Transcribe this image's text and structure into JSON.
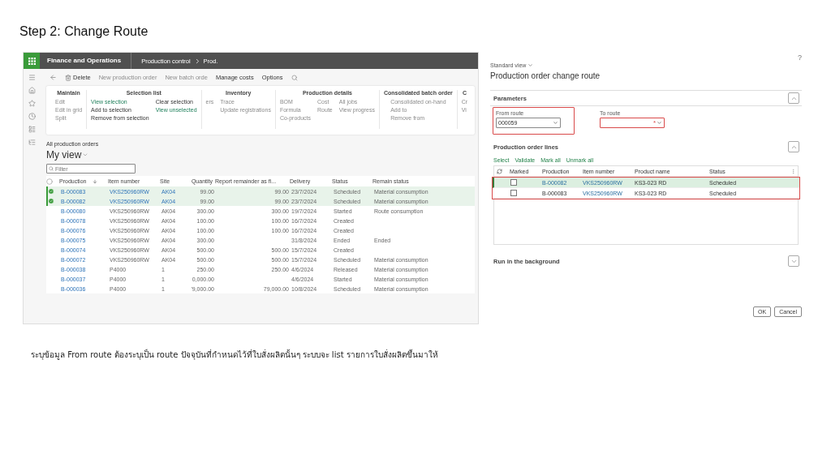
{
  "title": "Step 2: Change Route",
  "erp_window": {
    "app_title": "Finance and Operations",
    "breadcrumb": [
      "Production control",
      "Prod."
    ],
    "actions": [
      {
        "label": "Delete",
        "disabled": false,
        "kind": "delete"
      },
      {
        "label": "New production order",
        "disabled": true,
        "kind": "text"
      },
      {
        "label": "New batch orde",
        "disabled": true,
        "kind": "text"
      },
      {
        "label": "Manage costs",
        "disabled": false,
        "kind": "text"
      },
      {
        "label": "Options",
        "disabled": false,
        "kind": "text"
      }
    ],
    "ribbon": [
      {
        "title": "Maintain",
        "columns": [
          [
            {
              "label": "Edit",
              "disabled": true
            },
            {
              "label": "Edit in grid",
              "disabled": true
            },
            {
              "label": "Split",
              "disabled": true
            }
          ]
        ]
      },
      {
        "title": "Selection list",
        "columns": [
          [
            {
              "label": "View selection",
              "disabled": false,
              "link": true
            },
            {
              "label": "Add to selection",
              "disabled": false,
              "link": false
            },
            {
              "label": "Remove from selection",
              "disabled": false,
              "link": false
            }
          ],
          [
            {
              "label": "Clear selection",
              "disabled": false,
              "link": false
            },
            {
              "label": "View unselected",
              "disabled": false,
              "link": true
            }
          ]
        ]
      },
      {
        "title": "Inventory",
        "columns": [
          [
            {
              "label": "ers",
              "disabled": true
            }
          ],
          [
            {
              "label": "Trace",
              "disabled": true
            },
            {
              "label": "Update registrations",
              "disabled": true
            }
          ]
        ]
      },
      {
        "title": "Production details",
        "columns": [
          [
            {
              "label": "BOM",
              "disabled": true
            },
            {
              "label": "Formula",
              "disabled": true
            },
            {
              "label": "Co-products",
              "disabled": true
            }
          ],
          [
            {
              "label": "Cost",
              "disabled": true
            },
            {
              "label": "Route",
              "disabled": true
            }
          ],
          [
            {
              "label": "All jobs",
              "disabled": true
            },
            {
              "label": "View progress",
              "disabled": true
            }
          ]
        ]
      },
      {
        "title": "Consolidated batch order",
        "columns": [
          [
            {
              "label": "Consolidated on-hand",
              "disabled": true
            },
            {
              "label": "Add to",
              "disabled": true
            },
            {
              "label": "Remove from",
              "disabled": true
            }
          ]
        ]
      },
      {
        "title": "C",
        "columns": [
          [
            {
              "label": "Cr",
              "disabled": true
            },
            {
              "label": "Vi",
              "disabled": true
            }
          ]
        ]
      }
    ],
    "page_label": "All production orders",
    "view_name": "My view",
    "filter": {
      "placeholder": "Filter"
    },
    "table": {
      "columns": [
        "Production",
        "Item number",
        "Site",
        "Quantity",
        "Report remainder as fi...",
        "Delivery",
        "Status",
        "Remain status"
      ],
      "rows": [
        {
          "selected": true,
          "production": "B-000083",
          "item": "VKS250960RW",
          "site": "AK04",
          "quantity": "99.00",
          "remainder": "99.00",
          "delivery": "23/7/2024",
          "status": "Scheduled",
          "remain_status": "Material consumption"
        },
        {
          "selected": true,
          "production": "B-000082",
          "item": "VKS250960RW",
          "site": "AK04",
          "quantity": "99.00",
          "remainder": "99.00",
          "delivery": "23/7/2024",
          "status": "Scheduled",
          "remain_status": "Material consumption"
        },
        {
          "selected": false,
          "production": "B-000080",
          "item": "VKS250960RW",
          "site": "AK04",
          "quantity": "300.00",
          "remainder": "300.00",
          "delivery": "19/7/2024",
          "status": "Started",
          "remain_status": "Route consumption"
        },
        {
          "selected": false,
          "production": "B-000078",
          "item": "VKS250960RW",
          "site": "AK04",
          "quantity": "100.00",
          "remainder": "100.00",
          "delivery": "16/7/2024",
          "status": "Created"
        },
        {
          "selected": false,
          "production": "B-000076",
          "item": "VKS250960RW",
          "site": "AK04",
          "quantity": "100.00",
          "remainder": "100.00",
          "delivery": "16/7/2024",
          "status": "Created"
        },
        {
          "selected": false,
          "production": "B-000075",
          "item": "VKS250960RW",
          "site": "AK04",
          "quantity": "300.00",
          "delivery": "31/8/2024",
          "status": "Ended",
          "remain_status": "Ended"
        },
        {
          "selected": false,
          "production": "B-000074",
          "item": "VKS250960RW",
          "site": "AK04",
          "quantity": "500.00",
          "remainder": "500.00",
          "delivery": "15/7/2024",
          "status": "Created"
        },
        {
          "selected": false,
          "production": "B-000072",
          "item": "VKS250960RW",
          "site": "AK04",
          "quantity": "500.00",
          "remainder": "500.00",
          "delivery": "15/7/2024",
          "status": "Scheduled",
          "remain_status": "Material consumption"
        },
        {
          "selected": false,
          "production": "B-000038",
          "item": "P4000",
          "site": "1",
          "quantity": "250.00",
          "remainder": "250.00",
          "delivery": "4/6/2024",
          "status": "Released",
          "remain_status": "Material consumption"
        },
        {
          "selected": false,
          "production": "B-000037",
          "item": "P4000",
          "site": "1",
          "quantity": "0,000.00",
          "delivery": "4/6/2024",
          "status": "Started",
          "remain_status": "Material consumption"
        },
        {
          "selected": false,
          "production": "B-000036",
          "item": "P4000",
          "site": "1",
          "quantity": "'9,000.00",
          "remainder": "79,000.00",
          "delivery": "10/8/2024",
          "status": "Scheduled",
          "remain_status": "Material consumption"
        }
      ]
    }
  },
  "dialog": {
    "help": "?",
    "view_selector": "Standard view",
    "title": "Production order change route",
    "sections": [
      {
        "kind": "parameters",
        "title": "Parameters",
        "expanded": true,
        "fields": [
          {
            "label": "From route",
            "value": "000059",
            "required": false,
            "highlighted": true
          },
          {
            "label": "To route",
            "required": true,
            "highlighted": false
          }
        ]
      },
      {
        "kind": "lines",
        "title": "Production order lines",
        "expanded": true,
        "actions": [
          "Select",
          "Validate",
          "Mark all",
          "Unmark all"
        ],
        "columns": [
          "Marked",
          "Production",
          "Item number",
          "Product name",
          "Status"
        ],
        "rows_highlighted": true,
        "rows": [
          {
            "selected": true,
            "checked": false,
            "production": "B-000082",
            "item": "VKS250960RW",
            "product": "KS3-023 RD",
            "status": "Scheduled"
          },
          {
            "selected": false,
            "checked": false,
            "production": "B-000083",
            "item": "VKS250960RW",
            "product": "KS3-023 RD",
            "status": "Scheduled"
          }
        ]
      },
      {
        "kind": "plain",
        "title": "Run in the background",
        "expanded": false
      }
    ],
    "required_mark": "*",
    "buttons": [
      "OK",
      "Cancel"
    ]
  },
  "caption": "ระบุข้อมูล From route  ต้องระบุเป็น route ปัจจุบันที่กำหนดไว้ที่ใบสั่งผลิตนั้นๆ ระบบจะ list รายการใบสั่งผลิตขึ้นมาให้"
}
